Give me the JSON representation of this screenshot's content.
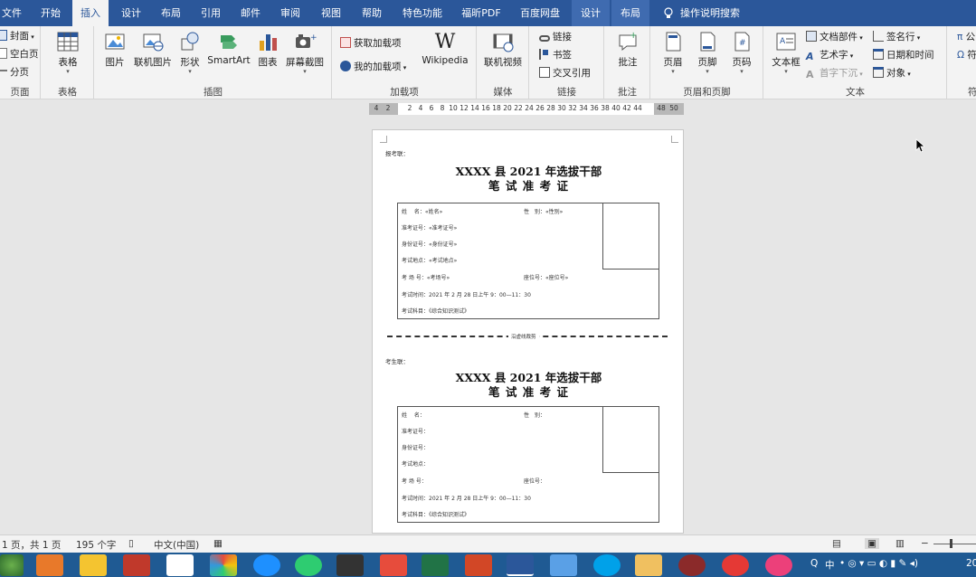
{
  "tabs": {
    "file": "文件",
    "home": "开始",
    "insert": "插入",
    "design": "设计",
    "layout": "布局",
    "references": "引用",
    "mailings": "邮件",
    "review": "审阅",
    "view": "视图",
    "help": "帮助",
    "special": "特色功能",
    "foxit": "福昕PDF",
    "baidu": "百度网盘",
    "table_design": "设计",
    "table_layout": "布局",
    "tell_me": "操作说明搜索"
  },
  "ribbon": {
    "pages": {
      "cover": "封面",
      "blank": "空白页",
      "break": "分页",
      "label": "页面"
    },
    "tables": {
      "table": "表格",
      "label": "表格"
    },
    "illustrations": {
      "picture": "图片",
      "online_picture": "联机图片",
      "shapes": "形状",
      "smartart": "SmartArt",
      "chart": "图表",
      "screenshot": "屏幕截图",
      "label": "插图"
    },
    "addins": {
      "get": "获取加载项",
      "my": "我的加载项",
      "wiki": "Wikipedia",
      "label": "加载项"
    },
    "media": {
      "online_video": "联机视频",
      "label": "媒体"
    },
    "links": {
      "link": "链接",
      "bookmark": "书签",
      "cross_ref": "交叉引用",
      "label": "链接"
    },
    "comments": {
      "comment": "批注",
      "label": "批注"
    },
    "header_footer": {
      "header": "页眉",
      "footer": "页脚",
      "page_number": "页码",
      "label": "页眉和页脚"
    },
    "text": {
      "textbox": "文本框",
      "quick_parts": "文档部件",
      "wordart": "艺术字",
      "dropcap": "首字下沉",
      "signature": "签名行",
      "datetime": "日期和时间",
      "object": "对象",
      "label": "文本"
    },
    "symbols": {
      "equation": "公",
      "symbol": "符",
      "label": "符"
    }
  },
  "ruler": {
    "left_nums": [
      "4",
      "2"
    ],
    "nums": [
      "2",
      "4",
      "6",
      "8",
      "10",
      "12",
      "14",
      "16",
      "18",
      "20",
      "22",
      "24",
      "26",
      "28",
      "30",
      "32",
      "34",
      "36",
      "38",
      "40",
      "42",
      "44"
    ],
    "right_nums": [
      "48",
      "50"
    ]
  },
  "document": {
    "top_label": "报考联：",
    "title_line1": "XXXX 县 2021 年选拔干部",
    "title_line2": "笔 试 准 考 证",
    "cut_label": "沿虚线裁剪",
    "bottom_label": "考生联：",
    "card1": {
      "name": "姓　 名：«姓名»",
      "gender": "性　别：«性别»",
      "ticket": "准考证号：«准考证号»",
      "id": "身份证号：«身份证号»",
      "place": "考试地点：«考试地点»",
      "room": "考 场 号：«考场号»",
      "seat": "座位号：«座位号»",
      "time": "考试时间：2021 年 2 月 28 日上午 9：00—11：30",
      "subject": "考试科目：《综合知识测试》"
    },
    "card2": {
      "name": "姓　 名：",
      "gender": "性　别：",
      "ticket": "准考证号：",
      "id": "身份证号：",
      "place": "考试地点：",
      "room": "考 场 号：",
      "seat": "座位号：",
      "time": "考试时间：2021 年 2 月 28 日上午 9：00—11：30",
      "subject": "考试科目：《综合知识测试》"
    },
    "return_mark": "↵"
  },
  "status": {
    "page": "1 页，共 1 页",
    "words": "195 个字",
    "lang": "中文(中国)"
  },
  "tray": {
    "ime": "中",
    "time": "20"
  },
  "colors": {
    "accent": "#2b579a",
    "taskbar": "#1f5a93"
  }
}
